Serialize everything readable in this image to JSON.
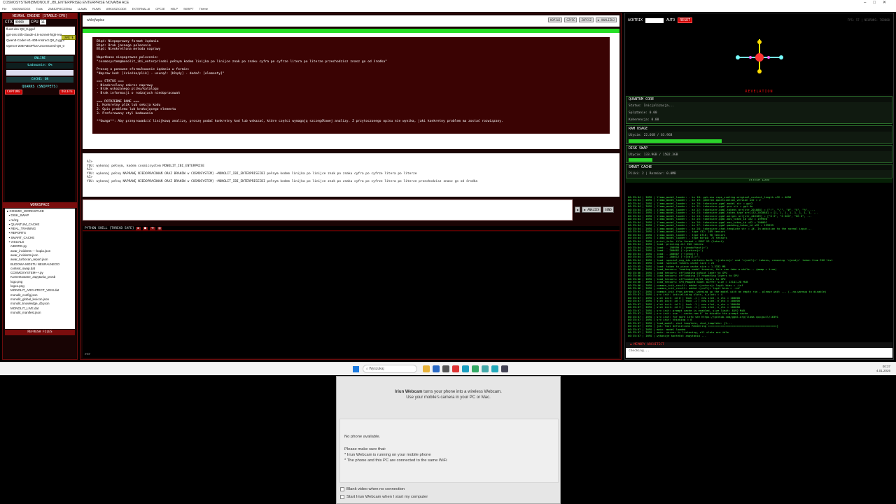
{
  "window": {
    "title": "COSMOSYSTEM(BMONOLIT_IBI_ENTERPRISE) ENTERPRISE NOVA/BA ACE"
  },
  "menu": [
    "File",
    "KNOWLEDGE",
    "Tools",
    "ZABEZPIECZENIA",
    "LLAMA",
    "RUMS",
    "ARKUSZ/CODE",
    "EXTERNAL AI",
    "OPCJE",
    "HELP",
    "SKRIPT",
    "Theme"
  ],
  "left": {
    "engine_title": "NEURAL ENGINE [STABLE-CPU]",
    "ctx_label": "CTX",
    "ctx_value": "99999",
    "cpu_label": "CPU",
    "cpu_value": "16",
    "ignite_label": "IGNITE",
    "models": [
      "flux2-dev-Q8_0.gguf",
      "gpt-oss-20b-claude-4.5-sonnet-high-rea",
      "Qwen3-Coder-V1-40B-Instruct.Q8_0.gguf",
      "OpenAI-20B-NEOPlus-Uncensored-Q8_0"
    ],
    "online": "ONLINE",
    "loading": "Ładowanie: 0%",
    "cache": "CACHE: ON",
    "quarks_title": "QUARKS (SNIPPETS)",
    "capture": "CAPTURE",
    "delete": "DELETE",
    "workspace_title": "WORKSPACE",
    "tree": [
      "▸ COSMIC_WORKSPACE",
      "  ▪ DISK_SWAP",
      "  ▪ mózg",
      "  ▪ QUANTUM_CACHE",
      "  ▪ REAL_TRAINING",
      "  ▪ REPORTS",
      "  ▪ SMART_CACHE",
      "  ▪ VISUALS",
      "    AIBORG.py",
      "    awar_incidents --- kopia.json",
      "    awar_incidents.json",
      "    awar_turbocan_report.json",
      "    BUDOWA MOSTU NEURALNEGO",
      "    context_swap.dat",
      "    COSMOSYSTEM++.py",
      "    Komentowane_zapytania_prosb",
      "    logo.png",
      "    logo1.png",
      "    MONOLIT_ARCHITECT_VEIN.dat",
      "    monolit_config.json",
      "    monolit_global_lexicon.json",
      "    monolit_knowledge_db.json",
      "    MONOLIT_LIVE.dat",
      "    monolit_manifest.json"
    ],
    "refresh": "REFRESH FILES"
  },
  "center": {
    "top_input": "wklej/wpisz",
    "top_buttons": [
      "KOPIUJ",
      "CZYŚĆ",
      "ZAPISZ",
      "▶ ANALIZUJ"
    ],
    "output": "Błąd: Niepoprawny format żądania\nBłąd: Brak jasnego polecenia\nBłąd: Nieokreślona metoda naprawy\n\nNapotkano niepoprawne polecenie:\n\"cosmosystem@monolit_ibi_enterprisebi pełnym kodem linijka po linijce znak po znaku cyfra po cyfrze litera po literze przechodzisz znasz go od środka\"\n\nProszę o ponowne sformułowanie żądania w formie:\n\"Napraw kod: [ścieżka/plik] - usunąć: [błędy] - dodać: [elementy]\"\n\n=== STATUS ===\n- Nieokreślony zakres naprawy\n- Brak wskazanego pliku/katalogu\n- Brak informacji o rodzajach niedopracowań\n\n=== POTRZEBNE DANE ===\n1. Konkretny plik lub sekcja kodu\n2. Opis problemu lub brakującego elementu\n3. Preferowany styl kodowania\n\n**Uwaga**: Aby przeprowadzić linijkową analizę, proszę podać konkretny kod lub wskazać, które części wymagają szczegółowej analizy. Z przytoczonego opisu nie wynika, jaki konkretny problem ma zostać rozwiązany.",
    "chat": "AI>\nYOU: wykonaj pełnym, kodem cosmicsystem MONOLIT_IBI_ENTERPRISE\nAI>\nYOU: wykonaj pełną NAPRAWĘ NIEDOPRACOWAŃ ORAZ BRAKÓW w COSMOSYSTEM] →MONOLIT_IBI_ENTERPRISEIBI pełnym kodem linijka po linijce znak po znaku cyfra po cyfrze litera po literze\nAI>\nYOU: wykonaj pełną NAPRAWĘ NIEDOPRACOWAŃ ORAZ BRAKÓW w COSMOSYSTEM] →MONOLIT_IBI_ENTERPRISEIBI pełnym kodem linijka po linijce znak po znaku cyfra po cyfrze litera po literze przechodzisz znasz go od środka",
    "send_buttons": [
      "◉",
      "▶ ANALIZA",
      "SEND"
    ],
    "term_title": "PYTHON SHELL [THREAD SAFE]",
    "term_buttons": [
      "▶",
      "■",
      "⟲",
      "▤"
    ],
    "term_prompt": ">>>"
  },
  "right": {
    "acknix": "ACKTRIX",
    "auto": "AUTO",
    "reset": "RESET",
    "stats": "FPS: 57 | NEURONS: 768000",
    "revelation": "REVELATION",
    "quantum": {
      "title": "QUANTUM CORE",
      "status": "Status: Inicjalizacja...",
      "splatanie": "Splątanie: 0.00",
      "koherencja": "Koherencja: 0.00"
    },
    "ram": {
      "title": "RAM USAGE",
      "value": "Użycie: 22.6GB / 63.9GB",
      "fraction": 0.35
    },
    "disk": {
      "title": "DISK SWAP",
      "value": "Użycie: 133.9GB / 1502.3GB",
      "fraction": 0.09
    },
    "smart": {
      "title": "SMART CACHE",
      "value": "Pliki: 2 | Rozmiar: 0.0MB"
    },
    "logs_title": "SYSTEM LOGS",
    "logs": "00:35:04 | INFO | llama_model_loader: - kv 18: gpt-oss.rope_scaling.original_context_length u32 = 4096\n00:35:04 | INFO | llama_model_loader: - kv 19: general.quantization_version u32 = 2\n00:35:04 | INFO | llama_model_loader: - kv 20: tokenizer.ggml.model str = gpt2\n00:35:04 | INFO | llama_model_loader: - kv 21: tokenizer.ggml.pre str = gpt-4o\n00:35:04 | INFO | llama_model_loader: - kv 22: tokenizer.ggml.tokens arr[str,201088] = [\"!\", \"\\\"\", \"#\", \"$\", \"%\", ...\n00:35:04 | INFO | llama_model_loader: - kv 23: tokenizer.ggml.token_type arr[i32,201088] = [1, 1, 1, 1, 1, 1, 1, 1, ...\n00:35:04 | INFO | llama_model_loader: - kv 24: tokenizer.ggml.merges arr[str,446189] = [\"Ġ Ġ\", \"Ġ ĠĠĠ\", \"ĠĠ Ġ\", ...\n00:35:04 | INFO | llama_model_loader: - kv 25: tokenizer.ggml.bos_token_id u32 = 199998\n00:35:04 | INFO | llama_model_loader: - kv 26: tokenizer.ggml.eos_token_id u32 = 200002\n00:35:04 | INFO | llama_model_loader: - kv 27: tokenizer.ggml.padding_token_id u32 = 199999\n00:35:04 | INFO | llama_model_loader: - kv 28: tokenizer.chat_template str = {#- In addition to the normal input...\n00:35:04 | INFO | llama_model_loader: - type f32: 289 tensors\n00:35:04 | INFO | llama_model_loader: - type bf16: 98 tensors\n00:35:04 | INFO | llama_model_loader: - type mxfp4: 72 tensors\n00:35:04 | INFO | print_info: file format = GGUF V3 (latest)\n00:35:04 | INFO | load: printing all EOG tokens:\n00:35:04 | INFO | load: - 199999 ('<|endoftext|>')\n00:35:04 | INFO | load: - 200002 ('<|return|>')\n00:35:04 | INFO | load: - 200007 ('<|end|>')\n00:35:04 | INFO | load: - 200012 ('<|call|>')\n00:35:04 | INFO | load: special_eog_ids contains both '<|return|>' and '<|call|>' tokens, removing '<|end|>' token from EOG list\n00:35:05 | INFO | load: special tokens cache size = 21\n00:35:05 | INFO | load: token to piece cache size = 1.3332 MB\n00:35:06 | INFO | load_tensors: loading model tensors, this can take a while... (mmap = true)\n00:35:06 | INFO | load_tensors: offloading output layer to GPU\n00:35:06 | INFO | load_tensors: offloading 23 repeating layers to GPU\n00:35:06 | INFO | load_tensors: offloaded 25/25 layers to GPU\n00:35:06 | INFO | load_tensors: CPU_Mapped model buffer size = 13141.28 MiB\n00:35:06 | INFO | common_init_result: added <|return|> logit bias = -inf\n00:35:06 | INFO | common_init_result: added <|call|> logit bias = -inf\n00:35:07 | INFO | common_init_from_params: warming up the model with an empty run - please wait ... (--no-warmup to disable)\n00:35:07 | INFO | srv init: initializing slots, n_slots = 4\n00:35:07 | INFO | slot init: id 0 | task -1 | new slot, n_ctx = 100000\n00:35:07 | INFO | slot init: id 1 | task -1 | new slot, n_ctx = 100000\n00:35:07 | INFO | slot init: id 2 | task -1 | new slot, n_ctx = 100000\n00:35:07 | INFO | slot init: id 3 | task -1 | new slot, n_ctx = 100000\n00:35:07 | INFO | srv init: prompt cache is enabled, size limit: 8192 MiB\n00:35:07 | INFO | srv init: use `--cache-ram 0` to disable the prompt cache\n00:35:07 | INFO | srv init: for more info see https://github.com/ggml-org/llama.cpp/pull/16391\n00:35:07 | INFO | srv init: thinking = 0\n00:35:07 | INFO | load_model: chat template, chat_template: {%...\n00:35:07 | INFO | [ok: Tool definitions Rendering ===========================================]\n00:35:07 | INFO | main: model loaded\n00:35:07 | INFO | main: server is listening, all slots are idle\n00:35:07 | INFO | wykonuje kontekst zapytania ...",
    "memory_title": "▪ MEMORY ARCHITECT",
    "memory_value": "checking..."
  },
  "taskbar": {
    "search": "Wyszukaj",
    "time": "00:37",
    "date": "4.01.2026"
  },
  "dialog": {
    "brand": "Iriun Webcam",
    "intro_rest": " turns your phone into a wireless Webcam.",
    "intro2": "Use your mobile's camera in your PC or Mac.",
    "no_phone": "No phone available.",
    "make_sure": "Please make sure that:",
    "point1": "* Iriun Webcam is running on your mobile phone",
    "point2": "* The phone and this PC are connected to the same WiFi",
    "check1": "Blank video when no connection",
    "check2": "Start Iriun Webcam when I start my computer"
  }
}
